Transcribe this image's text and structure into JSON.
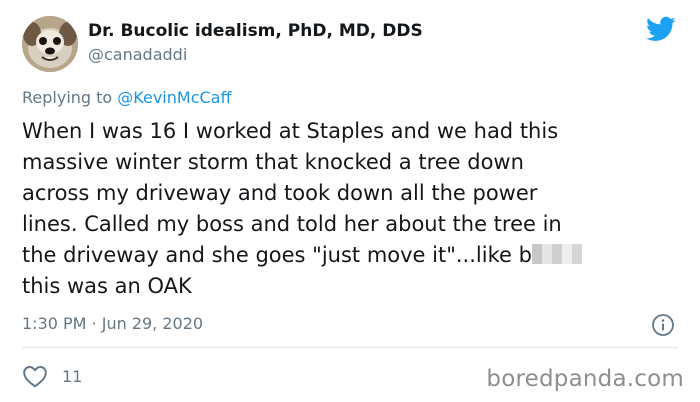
{
  "author": {
    "display_name": "Dr. Bucolic idealism, PhD, MD, DDS",
    "handle": "@canadaddi"
  },
  "icons": {
    "avatar": "dog-avatar",
    "logo": "twitter-bird-icon",
    "info": "info-icon",
    "like": "heart-icon"
  },
  "reply": {
    "prefix": "Replying to",
    "mention": "@KevinMcCaff"
  },
  "tweet": {
    "text_main": "When I was 16 I worked at Staples and we had this\nmassive winter storm that knocked a tree down\nacross my driveway and took down all the power\nlines. Called my boss and told her about the tree in\nthe driveway and she goes \"just move it\"...like b",
    "text_end": "this was an OAK",
    "timestamp": "1:30 PM · Jun 29, 2020"
  },
  "stats": {
    "likes": "11"
  },
  "watermark": "boredpanda.com",
  "colors": {
    "twitter_blue": "#1da1f2",
    "link_blue": "#1b95e0",
    "muted_gray": "#657786",
    "text": "#14171a"
  }
}
